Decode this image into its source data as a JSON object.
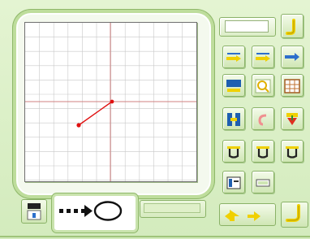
{
  "canvas": {
    "label_left": "",
    "label_right": "",
    "colors": {
      "grid": "#c8c8c8",
      "axis": "#d08080",
      "stitch": "#e01010"
    }
  },
  "coords": {
    "line1": "",
    "line2": ""
  },
  "buttons": [
    {
      "name": "undo-button",
      "icon": "undo-arrow-icon",
      "caption": ""
    },
    {
      "name": "feed-button-1",
      "icon": "arrow-right-icon",
      "caption": ""
    },
    {
      "name": "feed-button-2",
      "icon": "arrow-right-icon",
      "caption": ""
    },
    {
      "name": "feed-button-3",
      "icon": "arrow-right-icon",
      "caption": ""
    },
    {
      "name": "point-button",
      "icon": "point-icon",
      "caption": ""
    },
    {
      "name": "zoom-button",
      "icon": "magnifier-icon",
      "caption": ""
    },
    {
      "name": "grid-button",
      "icon": "grid-icon",
      "caption": ""
    },
    {
      "name": "presser-button",
      "icon": "presser-icon",
      "caption": ""
    },
    {
      "name": "thread-button",
      "icon": "thread-icon",
      "caption": ""
    },
    {
      "name": "needle-button",
      "icon": "needle-drop-icon",
      "caption": ""
    },
    {
      "name": "foot-button-1",
      "icon": "foot-icon",
      "caption": ""
    },
    {
      "name": "foot-button-2",
      "icon": "foot-icon",
      "caption": ""
    },
    {
      "name": "foot-button-3",
      "icon": "foot-icon",
      "caption": ""
    },
    {
      "name": "memory-button",
      "icon": "memory-icon",
      "caption": ""
    },
    {
      "name": "setting-button",
      "icon": "setting-icon",
      "caption": ""
    }
  ],
  "stitch_pattern": {
    "icon": "dotted-arrow-oval-icon"
  },
  "field": {
    "value": ""
  },
  "mode": {
    "icon": "mode-icon"
  },
  "nav": {
    "icon": "double-arrow-icon"
  },
  "ok": {
    "icon": "return-arrow-icon"
  }
}
